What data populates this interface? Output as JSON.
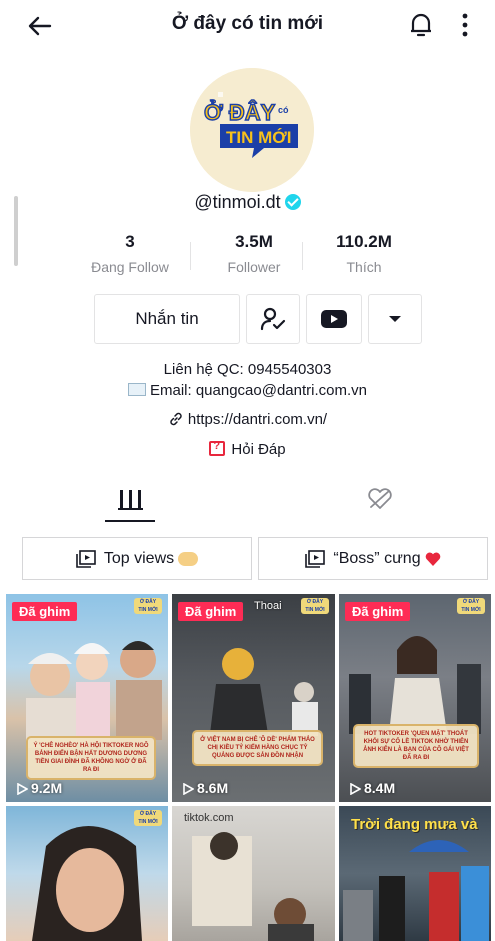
{
  "header": {
    "title": "Ở đây có tin mới",
    "back_icon": "arrow-left-icon",
    "bell_icon": "bell-icon",
    "more_icon": "more-vertical-icon"
  },
  "profile": {
    "avatar_text_top": "Ở ĐÂY",
    "avatar_text_small": "có",
    "avatar_text_bottom": "TIN MỚI",
    "handle": "@tinmoi.dt",
    "verified": true
  },
  "stats": [
    {
      "value": "3",
      "label": "Đang Follow"
    },
    {
      "value": "3.5M",
      "label": "Follower"
    },
    {
      "value": "110.2M",
      "label": "Thích"
    }
  ],
  "actions": {
    "message_label": "Nhắn tin",
    "follow_icon": "add-friend-icon",
    "youtube_icon": "youtube-icon",
    "dropdown_icon": "caret-down-icon"
  },
  "bio": {
    "line1": "Liên hệ QC: 0945540303",
    "line2": "Email: quangcao@dantri.com.vn",
    "link": "https://dantri.com.vn/",
    "qa": "Hỏi Đáp"
  },
  "tabs": {
    "videos_icon": "grid-icon",
    "liked_icon": "hidden-heart-icon"
  },
  "playlists": [
    {
      "label": "Top views"
    },
    {
      "label": "“Boss” cưng"
    }
  ],
  "videos": [
    {
      "pinned_label": "Đã ghim",
      "views": "9.2M",
      "caption": "Ý 'CHÊ NGHÈO' HÀ HỘI TIKTOKER NGÔ BẢNH ĐIỂN BẬN HẤT DƯƠNG DƯƠNG TIỀN GIAI ĐÌNH ĐÃ KHÔNG NGỜ Ở ĐÃ RA ĐI"
    },
    {
      "pinned_label": "Đã ghim",
      "views": "8.6M",
      "caption": "Ở VIỆT NAM BỊ CHÊ 'Ô DỀ' PHẢM THẢO CHỊ KIỀU TỶ KIẾM HÀNG CHỤC TỶ QUẢNG ĐƯỢC SẢN ĐỒN NHẬN",
      "extra": "Thoai"
    },
    {
      "pinned_label": "Đã ghim",
      "views": "8.4M",
      "caption": "HOT TIKTOKER 'QUEN MẶT' THOÁT KHỎI SỰ CỐ LỀ TIKTOK NHỜ THIÊN ẢNH KIÊN LÀ BẠN CỦA CÔ GÁI VIỆT ĐÃ RA ĐI"
    },
    {
      "views": ""
    },
    {
      "views": "",
      "extra": "tiktok.com"
    },
    {
      "views": "",
      "overlay": "Trời đang mưa và"
    }
  ],
  "colors": {
    "pin": "#fe2c55",
    "verified": "#20d5ec",
    "heart": "#e8273d",
    "caption_bg": "#f2e4c4"
  }
}
